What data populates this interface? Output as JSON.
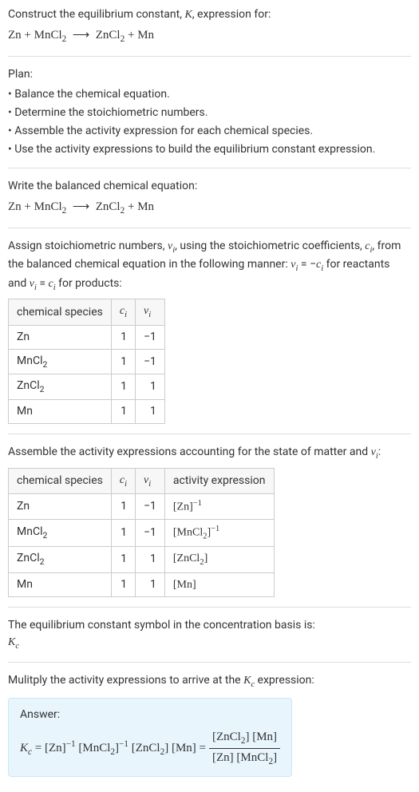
{
  "intro": {
    "line1": "Construct the equilibrium constant, K, expression for:",
    "eq": "Zn + MnCl₂  ⟶  ZnCl₂ + Mn"
  },
  "plan": {
    "heading": "Plan:",
    "items": [
      "• Balance the chemical equation.",
      "• Determine the stoichiometric numbers.",
      "• Assemble the activity expression for each chemical species.",
      "• Use the activity expressions to build the equilibrium constant expression."
    ]
  },
  "balanced": {
    "text": "Write the balanced chemical equation:",
    "eq": "Zn + MnCl₂  ⟶  ZnCl₂ + Mn"
  },
  "assign": {
    "text": "Assign stoichiometric numbers, νᵢ, using the stoichiometric coefficients, cᵢ, from the balanced chemical equation in the following manner: νᵢ = −cᵢ for reactants and νᵢ = cᵢ for products:"
  },
  "table1": {
    "headers": {
      "species": "chemical species",
      "c": "cᵢ",
      "v": "νᵢ"
    },
    "rows": [
      {
        "species": "Zn",
        "c": "1",
        "v": "−1"
      },
      {
        "species": "MnCl₂",
        "c": "1",
        "v": "−1"
      },
      {
        "species": "ZnCl₂",
        "c": "1",
        "v": "1"
      },
      {
        "species": "Mn",
        "c": "1",
        "v": "1"
      }
    ]
  },
  "assemble": {
    "text": "Assemble the activity expressions accounting for the state of matter and νᵢ:"
  },
  "table2": {
    "headers": {
      "species": "chemical species",
      "c": "cᵢ",
      "v": "νᵢ",
      "act": "activity expression"
    },
    "rows": [
      {
        "species": "Zn",
        "c": "1",
        "v": "−1",
        "act": "[Zn]⁻¹"
      },
      {
        "species": "MnCl₂",
        "c": "1",
        "v": "−1",
        "act": "[MnCl₂]⁻¹"
      },
      {
        "species": "ZnCl₂",
        "c": "1",
        "v": "1",
        "act": "[ZnCl₂]"
      },
      {
        "species": "Mn",
        "c": "1",
        "v": "1",
        "act": "[Mn]"
      }
    ]
  },
  "symbol": {
    "text": "The equilibrium constant symbol in the concentration basis is:",
    "sym": "K_c"
  },
  "multiply": {
    "text": "Mulitply the activity expressions to arrive at the K_c expression:"
  },
  "answer": {
    "label": "Answer:",
    "lhs": "K_c = [Zn]⁻¹ [MnCl₂]⁻¹ [ZnCl₂] [Mn] =",
    "frac_num": "[ZnCl₂] [Mn]",
    "frac_den": "[Zn] [MnCl₂]"
  },
  "chart_data": {
    "type": "table",
    "tables": [
      {
        "title": "Stoichiometric numbers",
        "columns": [
          "chemical species",
          "c_i",
          "ν_i"
        ],
        "rows": [
          [
            "Zn",
            1,
            -1
          ],
          [
            "MnCl2",
            1,
            -1
          ],
          [
            "ZnCl2",
            1,
            1
          ],
          [
            "Mn",
            1,
            1
          ]
        ]
      },
      {
        "title": "Activity expressions",
        "columns": [
          "chemical species",
          "c_i",
          "ν_i",
          "activity expression"
        ],
        "rows": [
          [
            "Zn",
            1,
            -1,
            "[Zn]^-1"
          ],
          [
            "MnCl2",
            1,
            -1,
            "[MnCl2]^-1"
          ],
          [
            "ZnCl2",
            1,
            1,
            "[ZnCl2]"
          ],
          [
            "Mn",
            1,
            1,
            "[Mn]"
          ]
        ]
      }
    ],
    "equilibrium_constant": "K_c = ([ZnCl2][Mn]) / ([Zn][MnCl2])"
  }
}
